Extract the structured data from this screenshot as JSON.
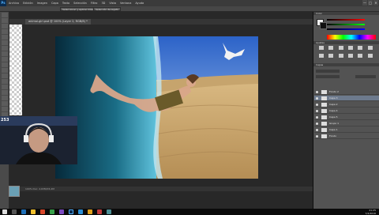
{
  "app": {
    "logo": "Ps",
    "menu": [
      "Archivo",
      "Edición",
      "Imagen",
      "Capa",
      "Texto",
      "Selección",
      "Filtro",
      "3D",
      "Vista",
      "Ventana",
      "Ayuda"
    ],
    "window_buttons": [
      "—",
      "□",
      "✕"
    ]
  },
  "options_bar": {
    "button1": "Seleccionar y aplicar máscara...",
    "button2": "Selección de sujeto"
  },
  "document": {
    "tab_title": "animal-girl.psd @ 100% (Layer 2, RGB/8) *",
    "status_text": "100%   Doc: 2,63M/15,2M",
    "overlay_number": "253"
  },
  "panels": {
    "color_header": "Color",
    "adjustments_header": "Ajustes",
    "layers_header": "Capas",
    "layers": [
      {
        "name": "Fondo 2",
        "selected": false
      },
      {
        "name": "Capa 3",
        "selected": true
      },
      {
        "name": "Capa 2",
        "selected": false
      },
      {
        "name": "Capa 4",
        "selected": false
      },
      {
        "name": "Capa 5",
        "selected": false
      },
      {
        "name": "Grupo 1",
        "selected": false
      },
      {
        "name": "Capa 1",
        "selected": false
      },
      {
        "name": "Fondo",
        "selected": false
      }
    ]
  },
  "taskbar": {
    "time": "21:25",
    "date": "7/4/2016"
  },
  "colors": {
    "ps_blue": "#4fb0ff",
    "sky_top": "#2c63c8",
    "sky_bottom": "#b9d3f2",
    "sand": "#caa36a",
    "water": "#1a6d86",
    "selected_layer": "#6d7a8d"
  }
}
